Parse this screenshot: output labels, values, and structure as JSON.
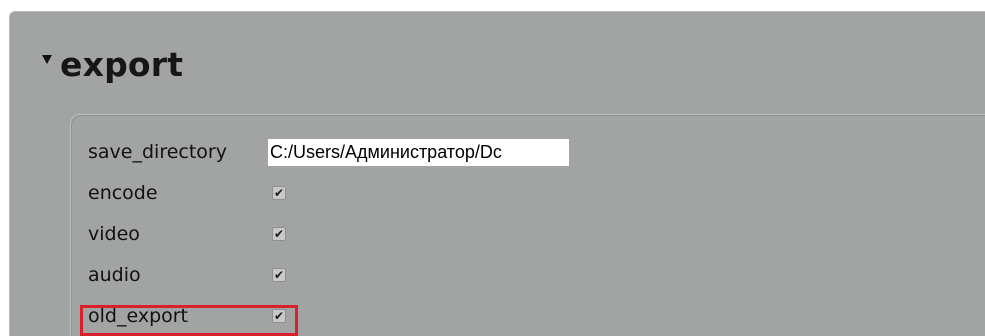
{
  "section": {
    "title": "export",
    "collapse_icon": "triangle-down-icon"
  },
  "settings": {
    "save_directory": {
      "label": "save_directory",
      "value": "C:/Users/Администратор/Dc"
    },
    "encode": {
      "label": "encode",
      "checked": true,
      "check_glyph": "✔"
    },
    "video": {
      "label": "video",
      "checked": true,
      "check_glyph": "✔"
    },
    "audio": {
      "label": "audio",
      "checked": true,
      "check_glyph": "✔"
    },
    "old_export": {
      "label": "old_export",
      "checked": true,
      "check_glyph": "✔"
    }
  },
  "colors": {
    "panel_bg": "#a2a4a3",
    "highlight": "#d9212b"
  }
}
